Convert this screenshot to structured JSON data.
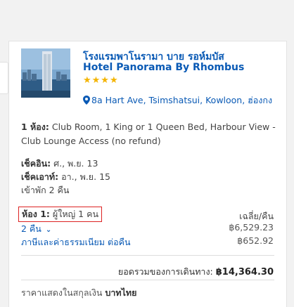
{
  "hotel": {
    "name_th": "โรงแรมพาโนรามา บาย รอห์มบัส",
    "name_en": "Hotel Panorama By Rhombus",
    "stars": "★★★★",
    "address": "8a Hart Ave, Tsimshatsui, Kowloon, ฮ่องกง"
  },
  "room": {
    "label": "1 ห้อง:",
    "description": "Club Room, 1 King or 1 Queen Bed, Harbour View - Club Lounge Access (no refund)"
  },
  "dates": {
    "checkin_label": "เช็คอิน:",
    "checkin_value": "ศ., พ.ย. 13",
    "checkout_label": "เช็คเอาท์:",
    "checkout_value": "อา., พ.ย. 15",
    "stay": "เข้าพัก 2 คืน"
  },
  "pricing": {
    "guests_label": "ห้อง 1:",
    "guests_value": "ผู้ใหญ่ 1 คน",
    "avg_label": "เฉลี่ย/คืน",
    "nights_label": "2 คืน",
    "nights_amount": "฿6,529.23",
    "taxes_label": "ภาษีและค่าธรรมเนียม ต่อคืน",
    "taxes_amount": "฿652.92",
    "total_label": "ยอดรวมของการเดินทาง:",
    "total_amount": "฿14,364.30",
    "currency_prefix": "ราคาแสดงในสกุลเงิน",
    "currency_name": "บาทไทย"
  },
  "colors": {
    "link": "#0a5ab5",
    "star": "#f4b400",
    "highlight_border": "#dd2222"
  }
}
